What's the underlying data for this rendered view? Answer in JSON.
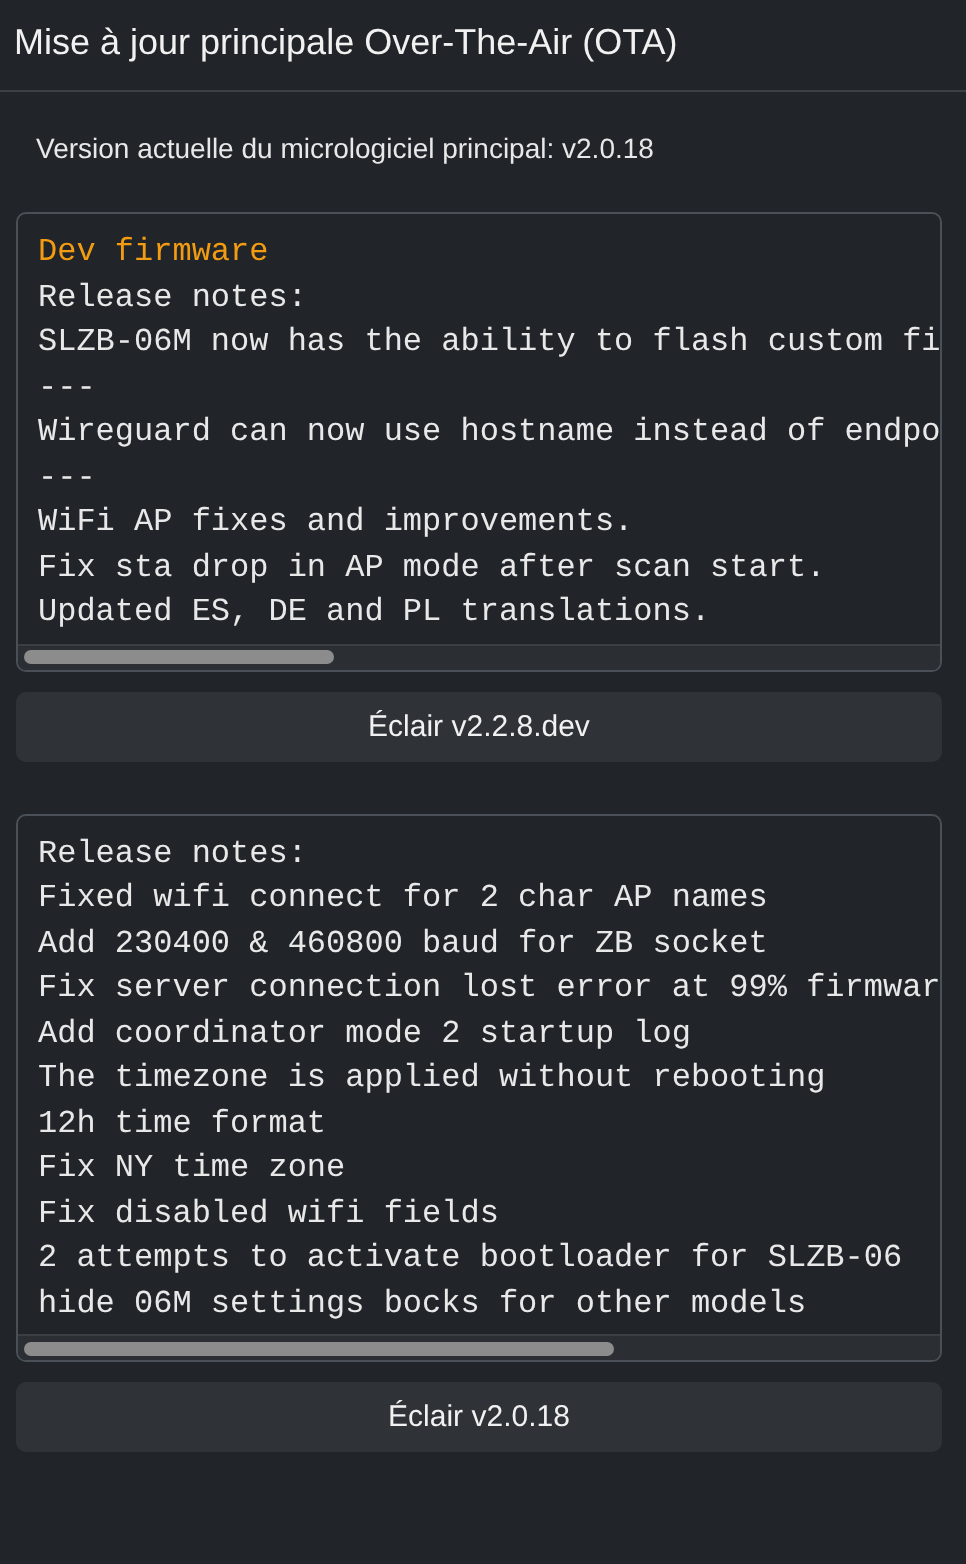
{
  "header": {
    "title": "Mise à jour principale Over-The-Air (OTA)"
  },
  "current_version": "Version actuelle du micrologiciel principal: v2.0.18",
  "releases": [
    {
      "title": "Dev firmware",
      "lines": [
        "Release notes:",
        "SLZB-06M now has the ability to flash custom fi",
        "---",
        "Wireguard can now use hostname instead of endpo",
        "---",
        "WiFi AP fixes and improvements.",
        "Fix sta drop in AP mode after scan start.",
        "Updated ES, DE and PL translations."
      ],
      "button": "Éclair v2.2.8.dev"
    },
    {
      "lines": [
        "Release notes:",
        "Fixed wifi connect for 2 char AP names",
        "Add 230400 & 460800 baud for ZB socket",
        "Fix server connection lost error at 99% firmwar",
        "Add coordinator mode 2 startup log",
        "The timezone is applied without rebooting",
        "12h time format",
        "Fix NY time zone",
        "Fix disabled wifi fields",
        "2 attempts to activate bootloader for SLZB-06",
        "hide 06M settings bocks for other models"
      ],
      "button": "Éclair v2.0.18"
    }
  ]
}
